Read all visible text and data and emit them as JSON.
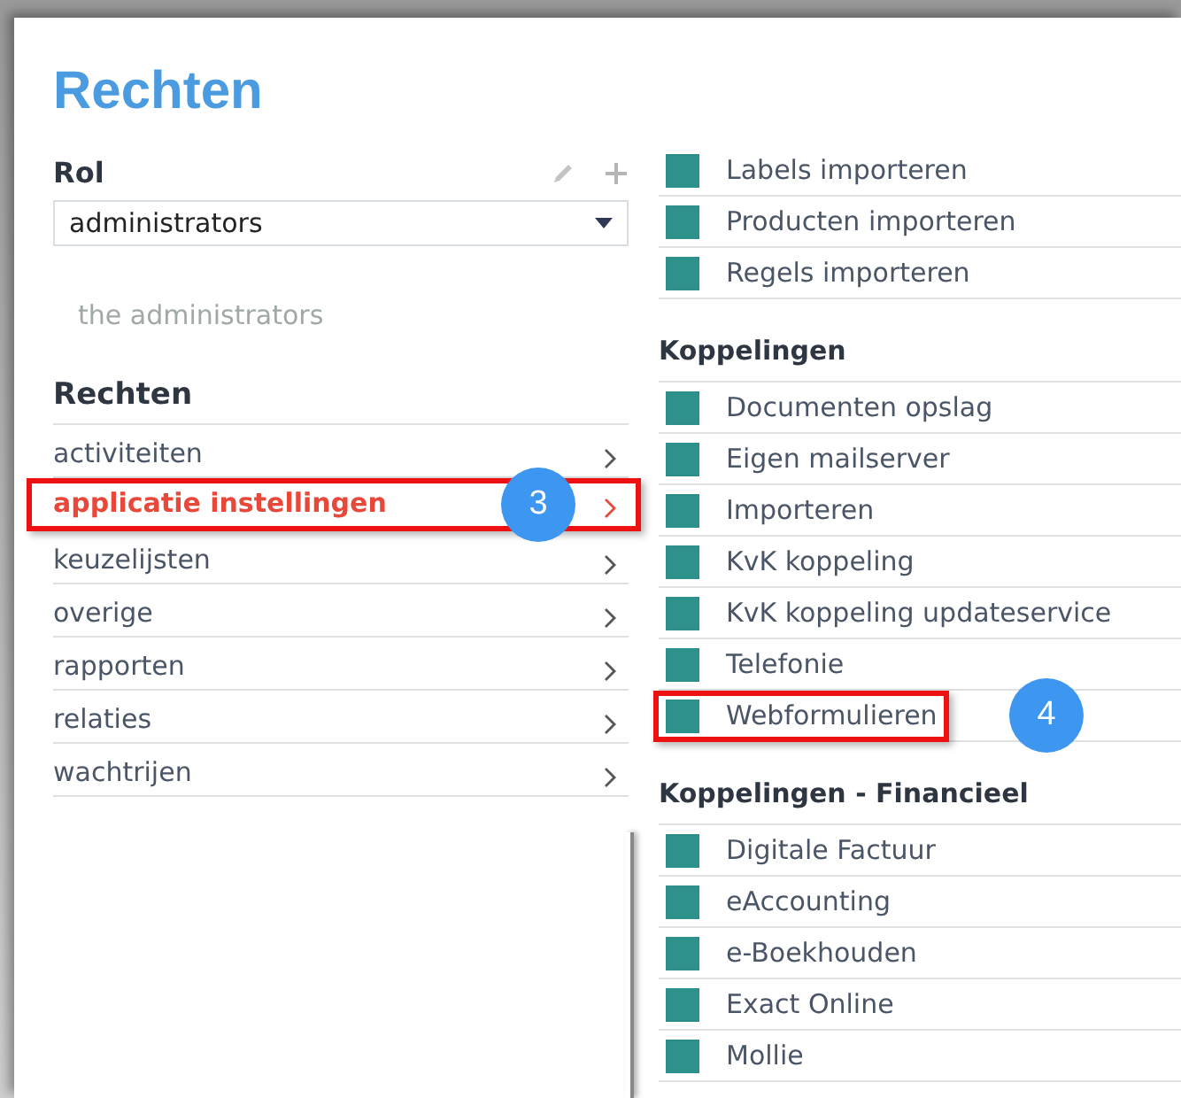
{
  "title": "Rechten",
  "role": {
    "label": "Rol",
    "value": "administrators",
    "description": "the administrators"
  },
  "rights": {
    "heading": "Rechten",
    "items": [
      {
        "label": "activiteiten",
        "selected": false,
        "highlighted": false
      },
      {
        "label": "applicatie instellingen",
        "selected": true,
        "highlighted": true,
        "callout": "3"
      },
      {
        "label": "keuzelijsten",
        "selected": false,
        "highlighted": false
      },
      {
        "label": "overige",
        "selected": false,
        "highlighted": false
      },
      {
        "label": "rapporten",
        "selected": false,
        "highlighted": false
      },
      {
        "label": "relaties",
        "selected": false,
        "highlighted": false
      },
      {
        "label": "wachtrijen",
        "selected": false,
        "highlighted": false
      }
    ]
  },
  "sections": [
    {
      "items": [
        {
          "label": "Labels importeren",
          "checked": true,
          "highlighted": false
        },
        {
          "label": "Producten importeren",
          "checked": true,
          "highlighted": false
        },
        {
          "label": "Regels importeren",
          "checked": true,
          "highlighted": false
        }
      ]
    },
    {
      "heading": "Koppelingen",
      "items": [
        {
          "label": "Documenten opslag",
          "checked": true,
          "highlighted": false
        },
        {
          "label": "Eigen mailserver",
          "checked": true,
          "highlighted": false
        },
        {
          "label": "Importeren",
          "checked": true,
          "highlighted": false
        },
        {
          "label": "KvK koppeling",
          "checked": true,
          "highlighted": false
        },
        {
          "label": "KvK koppeling updateservice",
          "checked": true,
          "highlighted": false
        },
        {
          "label": "Telefonie",
          "checked": true,
          "highlighted": false
        },
        {
          "label": "Webformulieren",
          "checked": true,
          "highlighted": true,
          "callout": "4"
        }
      ]
    },
    {
      "heading": "Koppelingen - Financieel",
      "items": [
        {
          "label": "Digitale Factuur",
          "checked": true,
          "highlighted": false
        },
        {
          "label": "eAccounting",
          "checked": true,
          "highlighted": false
        },
        {
          "label": "e-Boekhouden",
          "checked": true,
          "highlighted": false
        },
        {
          "label": "Exact Online",
          "checked": true,
          "highlighted": false
        },
        {
          "label": "Mollie",
          "checked": true,
          "highlighted": false
        }
      ]
    }
  ]
}
